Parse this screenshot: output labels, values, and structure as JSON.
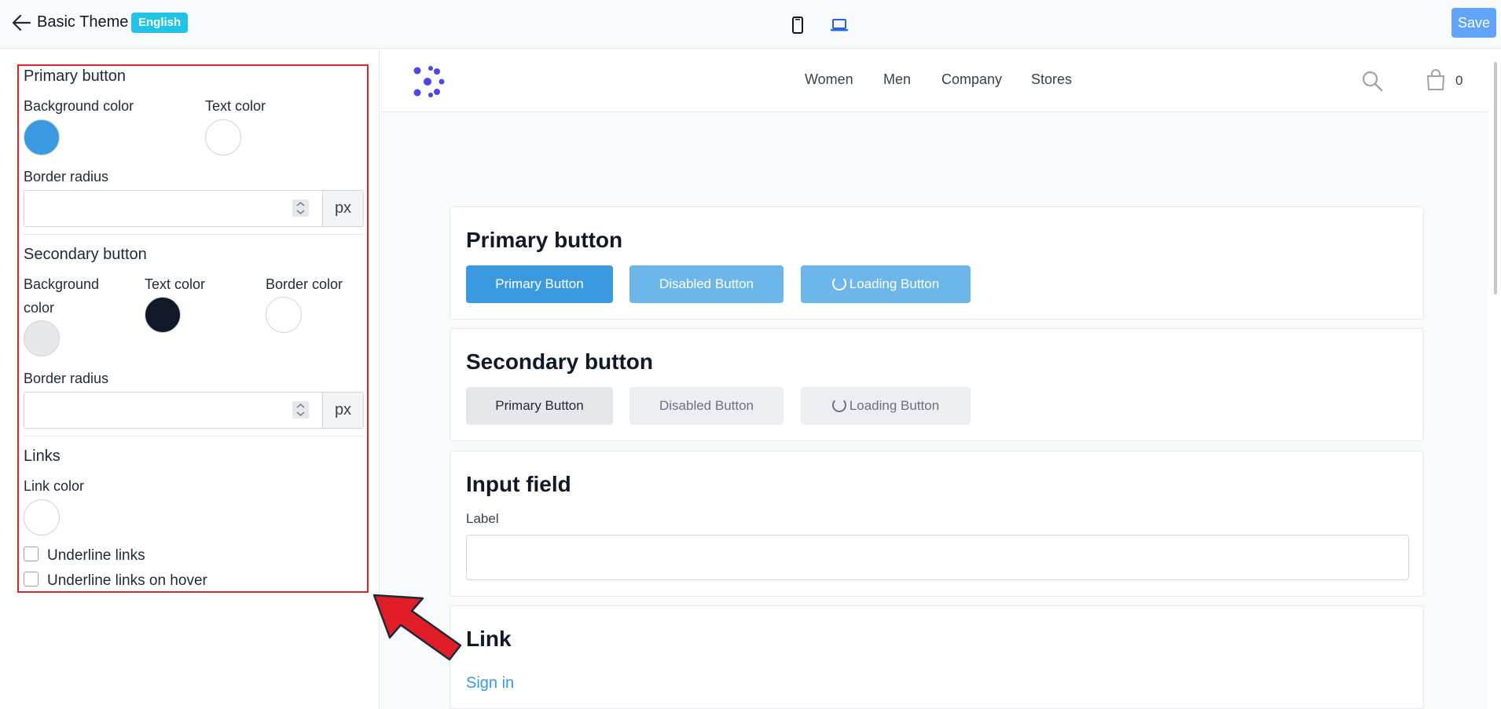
{
  "topbar": {
    "title": "Basic Theme",
    "language_badge": "English",
    "save_label": "Save",
    "icons": [
      "back-arrow-icon",
      "mobile-device-icon",
      "desktop-device-icon"
    ]
  },
  "settings": {
    "primary_button": {
      "heading": "Primary button",
      "background_color_label": "Background color",
      "text_color_label": "Text color",
      "background_color": "#3b99e0",
      "text_color": "#ffffff",
      "border_radius_label": "Border radius",
      "border_radius_value": "",
      "unit": "px"
    },
    "secondary_button": {
      "heading": "Secondary button",
      "background_color_label_line1": "Background",
      "background_color_label_line2": "color",
      "text_color_label": "Text color",
      "border_color_label": "Border color",
      "background_color": "#e5e7eb",
      "text_color": "#111827",
      "border_color": "#ffffff",
      "border_radius_label": "Border radius",
      "border_radius_value": "",
      "unit": "px"
    },
    "links": {
      "heading": "Links",
      "link_color_label": "Link color",
      "link_color": "#ffffff",
      "underline_links_label": "Underline links",
      "underline_links_checked": false,
      "underline_hover_label": "Underline links on hover",
      "underline_hover_checked": false
    }
  },
  "preview": {
    "nav": [
      "Women",
      "Men",
      "Company",
      "Stores"
    ],
    "cart_count": "0",
    "icons": [
      "logo-icon",
      "search-icon",
      "shopping-bag-icon"
    ],
    "primary_section": {
      "title": "Primary button",
      "buttons": [
        "Primary Button",
        "Disabled Button",
        "Loading Button"
      ]
    },
    "secondary_section": {
      "title": "Secondary button",
      "buttons": [
        "Primary Button",
        "Disabled Button",
        "Loading Button"
      ]
    },
    "input_section": {
      "title": "Input field",
      "label": "Label",
      "value": ""
    },
    "link_section": {
      "title": "Link",
      "link_text": "Sign in"
    }
  },
  "colors": {
    "accent": "#3b99e0",
    "save_button": "#60a5fa",
    "badge": "#22c3e6",
    "highlight_box": "#dc2626",
    "logo": "#4f46e5"
  }
}
